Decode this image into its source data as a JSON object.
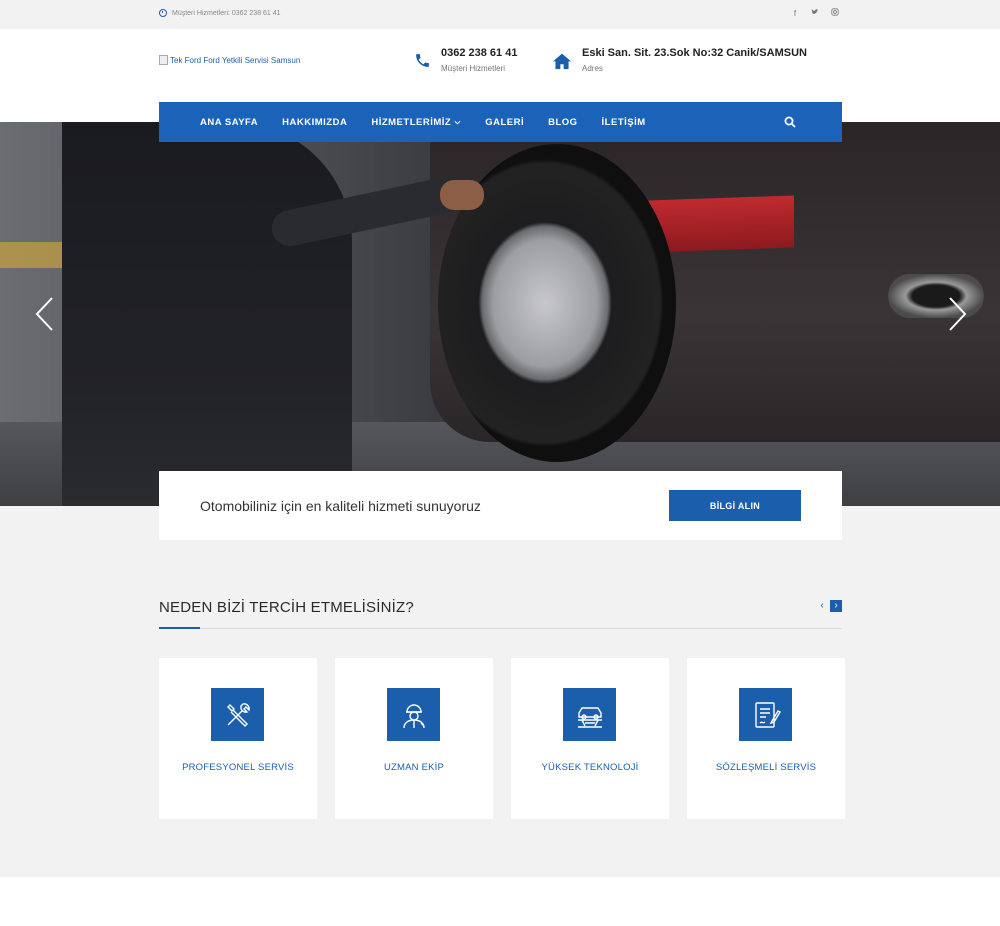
{
  "topbar": {
    "contact_text": "Müşteri Hizmetleri: 0362 238 61 41",
    "social": [
      "facebook-icon",
      "twitter-icon",
      "instagram-icon"
    ]
  },
  "header": {
    "logo_alt": "Tek Ford Ford Yetkili Servisi Samsun",
    "phone": {
      "title": "0362 238 61 41",
      "subtitle": "Müşteri Hizmetleri"
    },
    "address": {
      "title": "Eski San. Sit. 23.Sok No:32 Canik/SAMSUN",
      "subtitle": "Adres"
    }
  },
  "nav": {
    "items": [
      {
        "label": "ANA SAYFA"
      },
      {
        "label": "HAKKIMIZDA"
      },
      {
        "label": "HİZMETLERİMİZ"
      },
      {
        "label": "GALERİ"
      },
      {
        "label": "BLOG"
      },
      {
        "label": "İLETİŞİM"
      }
    ]
  },
  "slogan": {
    "text": "Otomobiliniz için en kaliteli hizmeti sunuyoruz",
    "button": "BİLGİ ALIN"
  },
  "why_us": {
    "title": "NEDEN BİZİ TERCİH ETMELİSİNİZ?",
    "cards": [
      {
        "label": "PROFESYONEL SERVİS",
        "icon": "tools-icon"
      },
      {
        "label": "UZMAN EKİP",
        "icon": "technician-icon"
      },
      {
        "label": "YÜKSEK TEKNOLOJİ",
        "icon": "car-lift-icon"
      },
      {
        "label": "SÖZLEŞMELİ SERVİS",
        "icon": "contract-icon"
      }
    ]
  },
  "colors": {
    "brand": "#1a63b9",
    "section_bg": "#f2f2f2"
  }
}
